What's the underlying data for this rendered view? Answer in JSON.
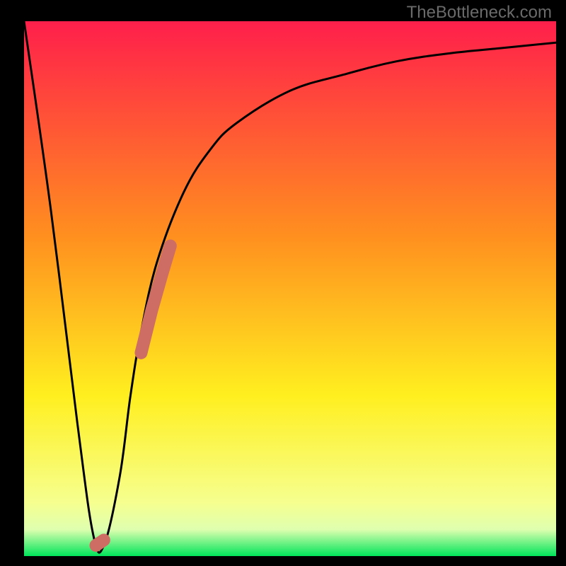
{
  "watermark": "TheBottleneck.com",
  "colors": {
    "black": "#000000",
    "curve": "#000000",
    "segment": "#cd6d64",
    "gradient_top": "#ff1f4b",
    "gradient_mid1": "#ff8f1f",
    "gradient_mid2": "#ffef1f",
    "gradient_band_top": "#f6ff8f",
    "gradient_band_mid": "#dfffaf",
    "gradient_bottom": "#00e55b"
  },
  "chart_data": {
    "type": "line",
    "title": "",
    "xlabel": "",
    "ylabel": "",
    "xlim": [
      0,
      100
    ],
    "ylim": [
      0,
      100
    ],
    "grid": false,
    "legend": false,
    "series": [
      {
        "name": "bottleneck-curve",
        "x": [
          0,
          5,
          10,
          13,
          15,
          18,
          20,
          22,
          25,
          30,
          35,
          40,
          50,
          60,
          70,
          80,
          90,
          100
        ],
        "y": [
          100,
          65,
          25,
          4,
          2,
          15,
          30,
          42,
          55,
          68,
          76,
          81,
          87,
          90,
          92.5,
          94,
          95,
          96
        ]
      }
    ],
    "highlight_segments": [
      {
        "name": "dip-marker",
        "x": [
          13.5,
          15.0
        ],
        "y": [
          2.0,
          3.0
        ],
        "stroke_width": 18
      },
      {
        "name": "ascending-marker",
        "x": [
          22.0,
          24.0,
          26.0,
          27.5
        ],
        "y": [
          38.0,
          46.0,
          53.0,
          58.0
        ],
        "stroke_width": 18
      }
    ]
  }
}
